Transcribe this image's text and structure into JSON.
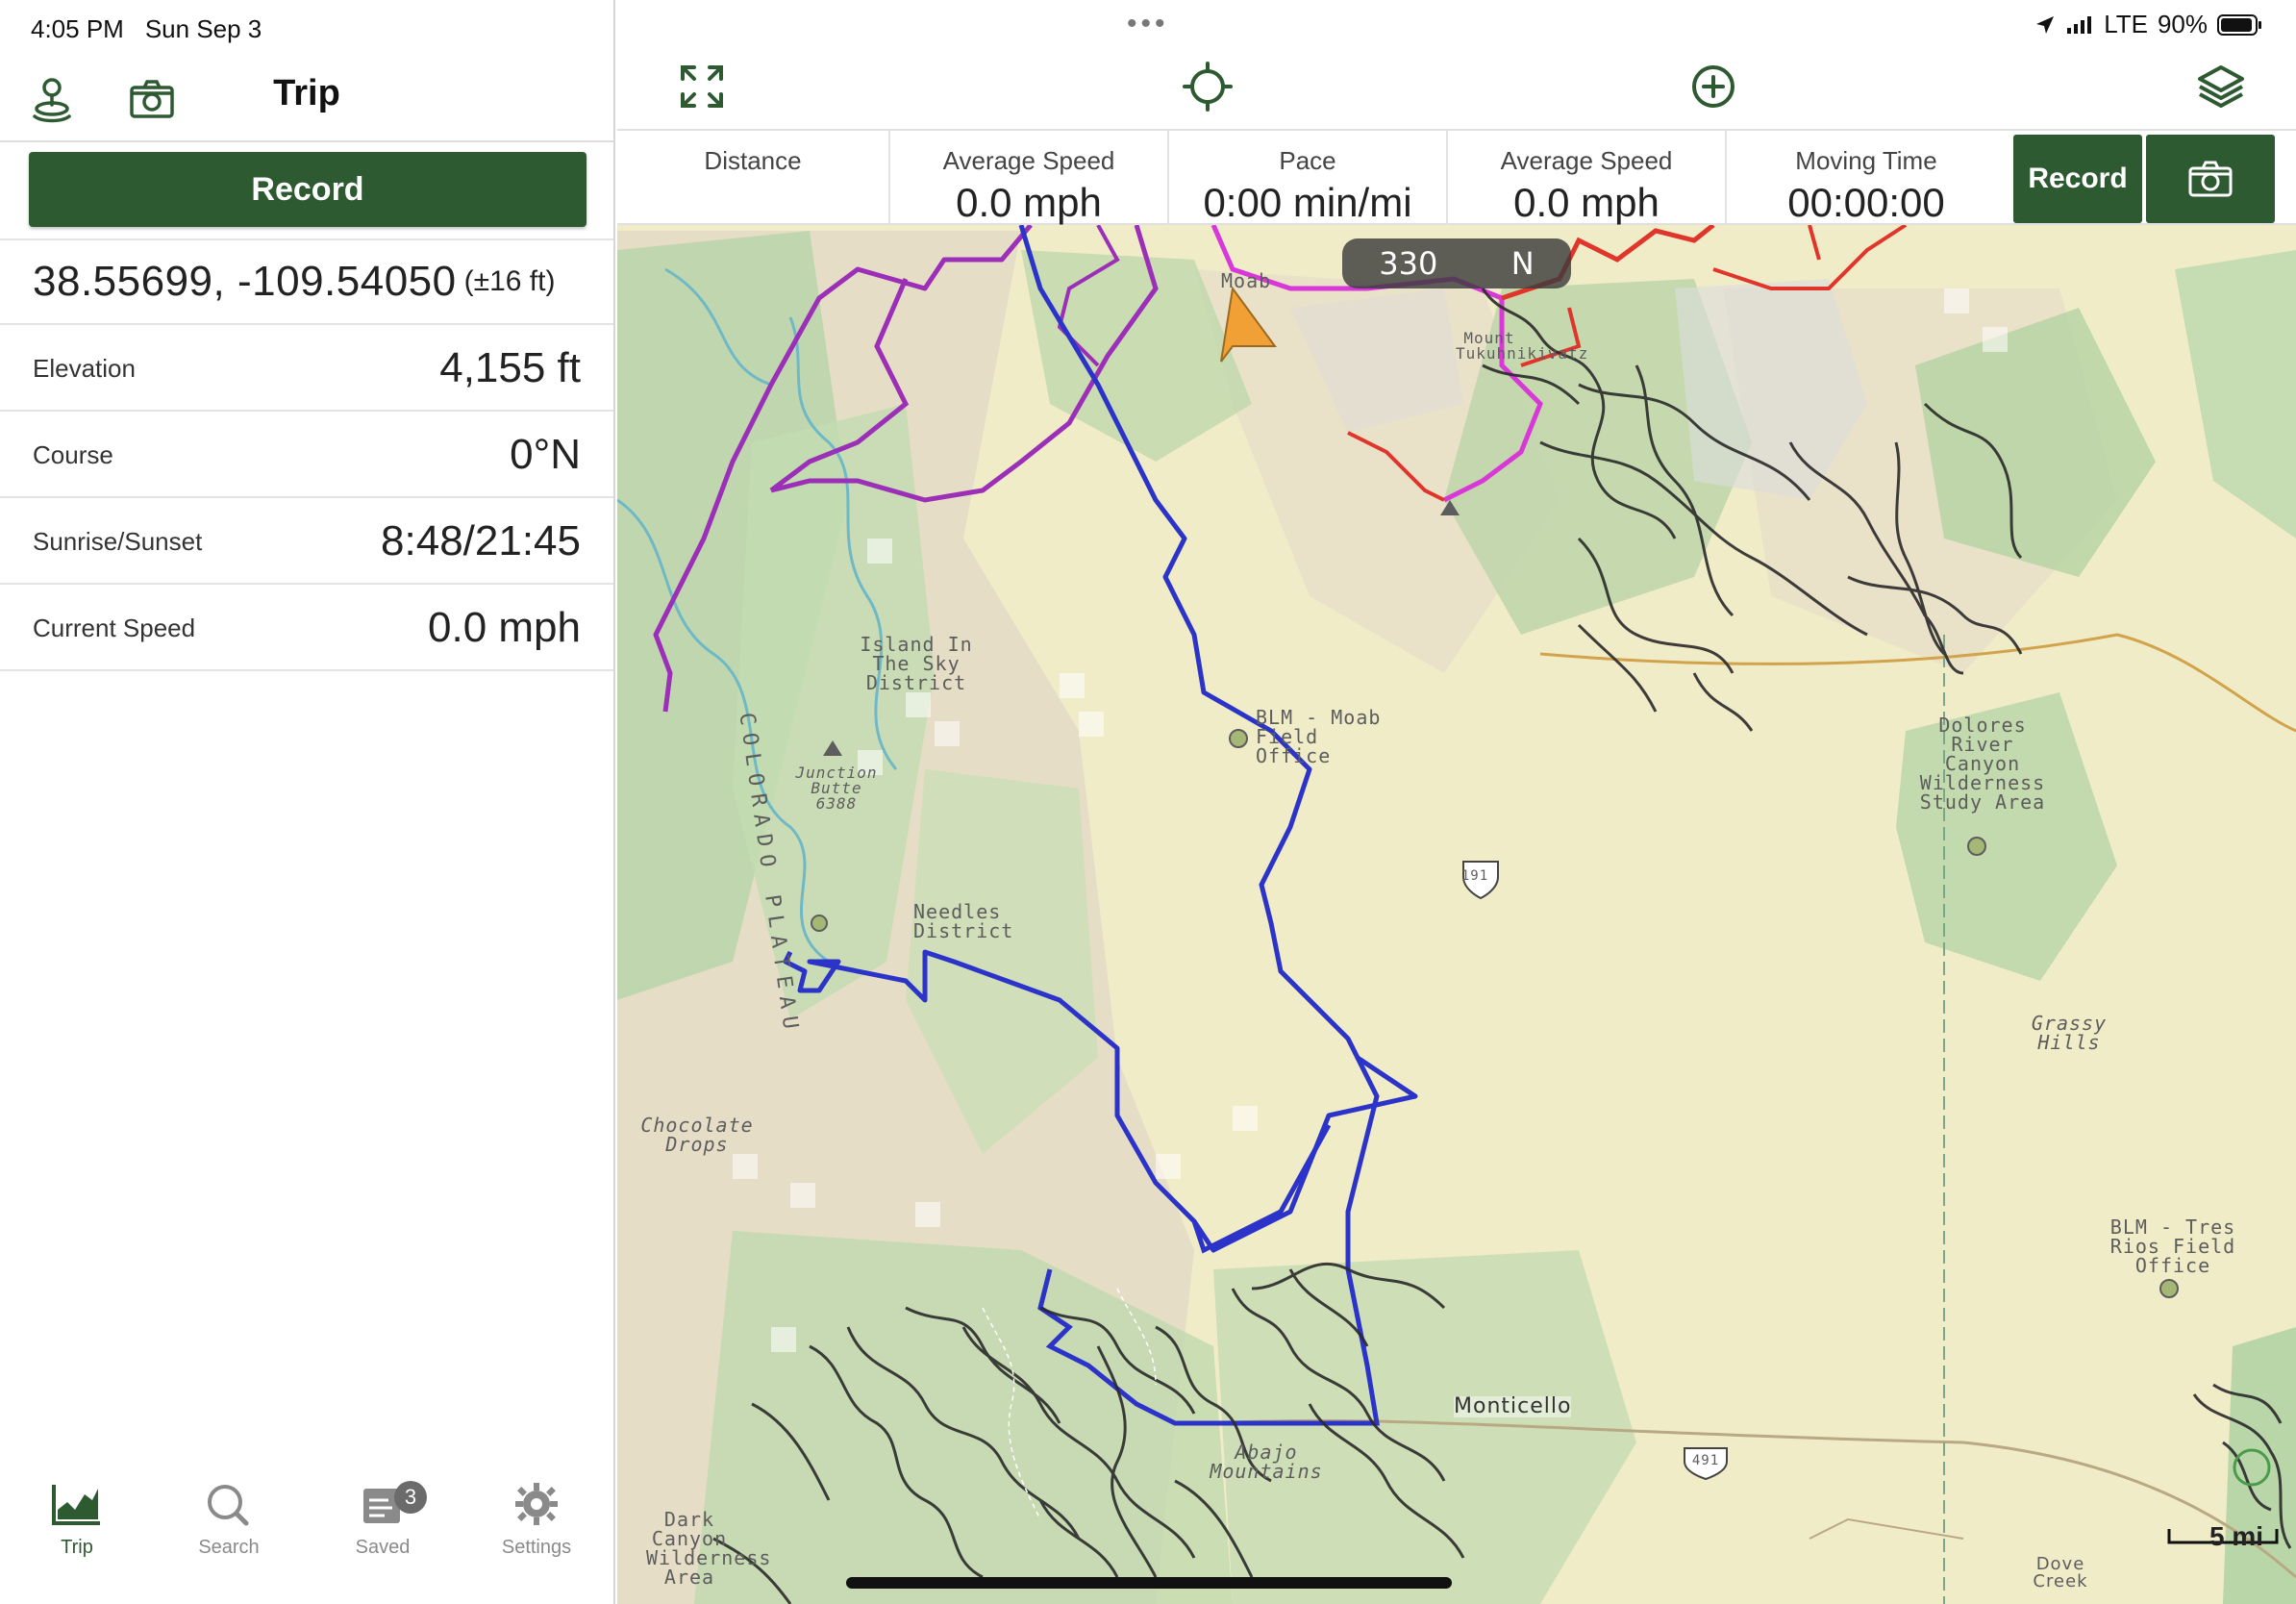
{
  "status_bar": {
    "time": "4:05 PM",
    "date": "Sun Sep 3",
    "network": "LTE",
    "battery": "90%"
  },
  "trip_panel": {
    "title": "Trip",
    "record_label": "Record",
    "coordinates": "38.55699, -109.54050",
    "accuracy": "(±16 ft)",
    "stats": [
      {
        "label": "Elevation",
        "value": "4,155 ft"
      },
      {
        "label": "Course",
        "value": "0°N"
      },
      {
        "label": "Sunrise/Sunset",
        "value": "8:48/21:45"
      },
      {
        "label": "Current Speed",
        "value": "0.0 mph"
      }
    ]
  },
  "tabs": [
    {
      "label": "Trip",
      "icon": "trip-chart-icon",
      "active": true
    },
    {
      "label": "Search",
      "icon": "search-icon",
      "active": false
    },
    {
      "label": "Saved",
      "icon": "saved-icon",
      "badge": "3",
      "active": false
    },
    {
      "label": "Settings",
      "icon": "gear-icon",
      "active": false
    }
  ],
  "map_toolbar": {
    "icons": [
      "expand-icon",
      "locate-icon",
      "add-icon",
      "layers-icon"
    ]
  },
  "stats_bar": {
    "cells": [
      {
        "label": "Distance",
        "value": ""
      },
      {
        "label": "Average Speed",
        "value": "0.0 mph"
      },
      {
        "label": "Pace",
        "value": "0:00 min/mi"
      },
      {
        "label": "Average Speed",
        "value": "0.0 mph"
      },
      {
        "label": "Moving Time",
        "value": "00:00:00"
      }
    ],
    "record_label": "Record"
  },
  "compass": {
    "heading": "330",
    "direction": "N"
  },
  "map_labels": {
    "moab": "Moab",
    "island": "Island In The Sky District",
    "colorado_plateau": "COLORADO PLATEAU",
    "junction_butte": "Junction Butte 6388",
    "blm_moab": "BLM - Moab Field Office",
    "dolores": "Dolores River Canyon Wilderness Study Area",
    "needles": "Needles District",
    "chocolate": "Chocolate Drops",
    "grassy": "Grassy Hills",
    "blm_tres": "BLM - Tres Rios Field Office",
    "monticello": "Monticello",
    "mount_tukuhnikivatz": "Mount Tukuhnikivatz",
    "route_191": "191",
    "route_491": "491",
    "dark_canyon": "Dark Canyon Wilderness Area",
    "abajo": "Abajo Mountains",
    "dove_creek": "Dove Creek",
    "scale": "5 mi"
  },
  "colors": {
    "brand_green": "#2e5a32",
    "route_blue": "#2b33c9",
    "route_purple": "#9b2fb8",
    "route_magenta": "#d838d8",
    "route_red": "#e0352b",
    "land_yellow": "#f4efc4",
    "land_green": "#b8d6a8",
    "land_tan": "#e6dcc6"
  }
}
